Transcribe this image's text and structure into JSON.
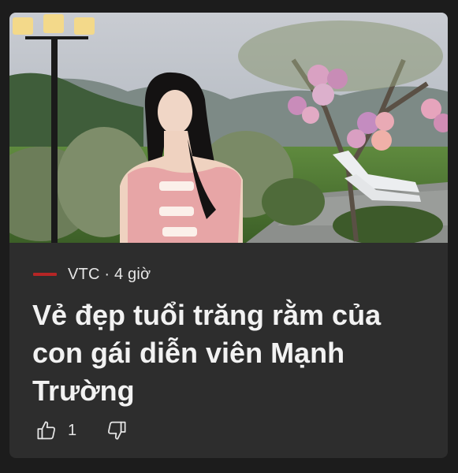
{
  "card": {
    "source": "VTC",
    "time": "4 giờ",
    "meta_text": "VTC · 4 giờ",
    "title": "Vẻ đẹp tuổi trăng rằm của con gái diễn viên Mạnh Trường",
    "likes": "1",
    "icons": {
      "source_logo": "vtc-logo",
      "like": "thumbs-up-icon",
      "dislike": "thumbs-down-icon"
    }
  },
  "colors": {
    "card_bg": "#2d2d2d",
    "page_bg": "#1c1c1c",
    "text": "#f2f2f2",
    "brand_red": "#b52525"
  }
}
